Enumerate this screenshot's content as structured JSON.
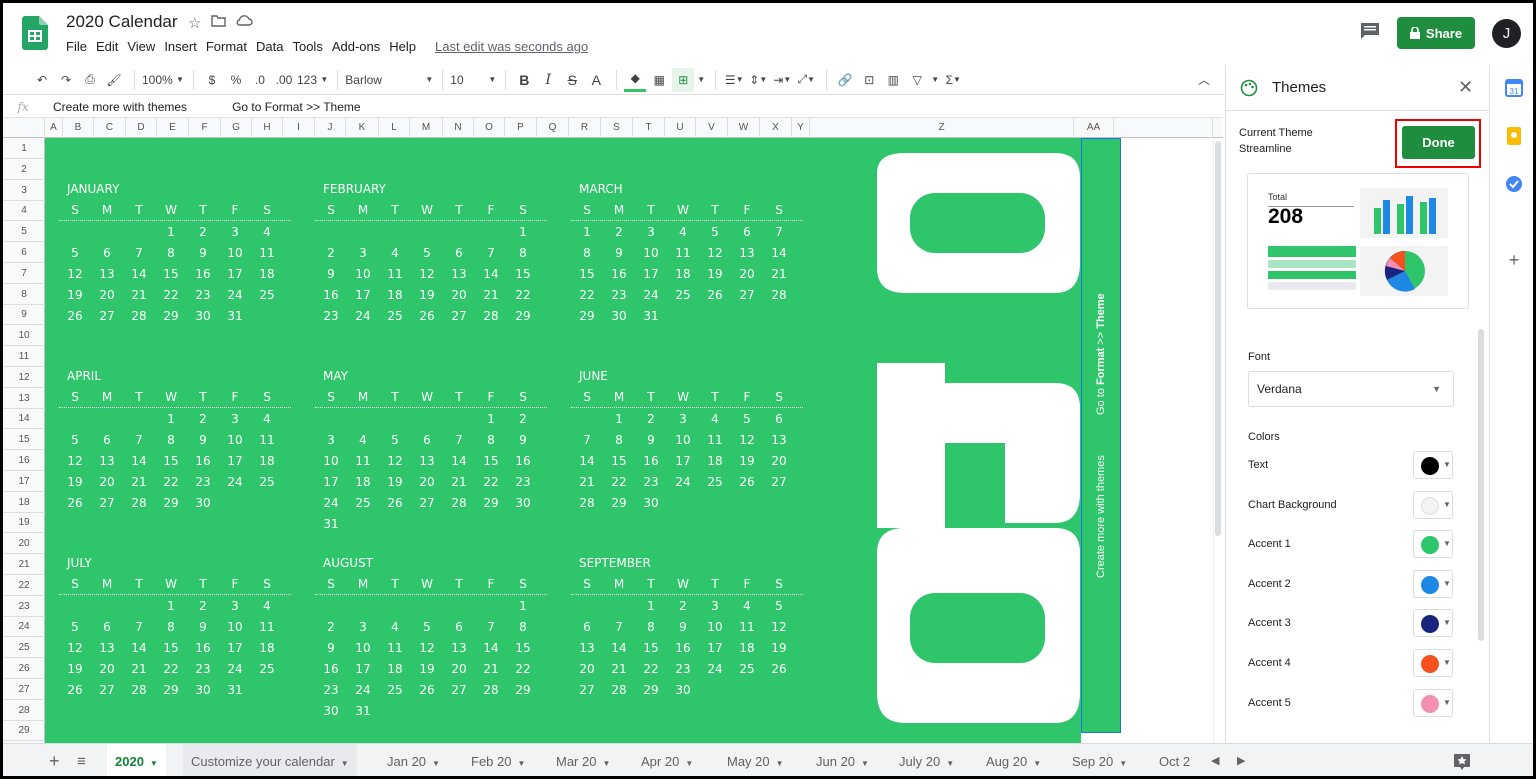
{
  "header": {
    "title": "2020 Calendar",
    "menu": [
      "File",
      "Edit",
      "View",
      "Insert",
      "Format",
      "Data",
      "Tools",
      "Add-ons",
      "Help"
    ],
    "last_edit": "Last edit was seconds ago",
    "share_label": "Share",
    "avatar_letter": "J"
  },
  "toolbar": {
    "zoom": "100%",
    "currency": "$",
    "percent": "%",
    "dec_less": ".0",
    "dec_more": ".00",
    "format_more": "123",
    "font": "Barlow",
    "font_size": "10",
    "bold": "B",
    "italic": "I",
    "strike": "S",
    "text_color": "A",
    "sum": "Σ"
  },
  "formula": {
    "fx": "fx",
    "text1": "Create more with themes",
    "text2": "Go to  Format  >> Theme"
  },
  "columns": [
    "A",
    "B",
    "C",
    "D",
    "E",
    "F",
    "G",
    "H",
    "I",
    "J",
    "K",
    "L",
    "M",
    "N",
    "O",
    "P",
    "Q",
    "R",
    "S",
    "T",
    "U",
    "V",
    "W",
    "X",
    "Y",
    "Z",
    "AA"
  ],
  "rows": [
    "1",
    "2",
    "3",
    "4",
    "5",
    "6",
    "7",
    "8",
    "9",
    "10",
    "11",
    "12",
    "13",
    "14",
    "15",
    "16",
    "17",
    "18",
    "19",
    "20",
    "21",
    "22",
    "23",
    "24",
    "25",
    "26",
    "27",
    "28",
    "29"
  ],
  "calendar": {
    "dow": [
      "S",
      "M",
      "T",
      "W",
      "T",
      "F",
      "S"
    ],
    "year_digits": [
      "2",
      "0",
      "2",
      "0"
    ],
    "side_text_1": "Create more with themes",
    "side_text_2_a": "Go to ",
    "side_text_2_b": "Format",
    "side_text_2_c": " >> ",
    "side_text_2_d": "Theme",
    "months": [
      {
        "name": "JANUARY",
        "weeks": [
          [
            "",
            "",
            "",
            "1",
            "2",
            "3",
            "4"
          ],
          [
            "5",
            "6",
            "7",
            "8",
            "9",
            "10",
            "11"
          ],
          [
            "12",
            "13",
            "14",
            "15",
            "16",
            "17",
            "18"
          ],
          [
            "19",
            "20",
            "21",
            "22",
            "23",
            "24",
            "25"
          ],
          [
            "26",
            "27",
            "28",
            "29",
            "30",
            "31",
            ""
          ]
        ]
      },
      {
        "name": "FEBRUARY",
        "weeks": [
          [
            "",
            "",
            "",
            "",
            "",
            "",
            "1"
          ],
          [
            "2",
            "3",
            "4",
            "5",
            "6",
            "7",
            "8"
          ],
          [
            "9",
            "10",
            "11",
            "12",
            "13",
            "14",
            "15"
          ],
          [
            "16",
            "17",
            "18",
            "19",
            "20",
            "21",
            "22"
          ],
          [
            "23",
            "24",
            "25",
            "26",
            "27",
            "28",
            "29"
          ]
        ]
      },
      {
        "name": "MARCH",
        "weeks": [
          [
            "1",
            "2",
            "3",
            "4",
            "5",
            "6",
            "7"
          ],
          [
            "8",
            "9",
            "10",
            "11",
            "12",
            "13",
            "14"
          ],
          [
            "15",
            "16",
            "17",
            "18",
            "19",
            "20",
            "21"
          ],
          [
            "22",
            "23",
            "24",
            "25",
            "26",
            "27",
            "28"
          ],
          [
            "29",
            "30",
            "31",
            "",
            "",
            "",
            ""
          ]
        ]
      },
      {
        "name": "APRIL",
        "weeks": [
          [
            "",
            "",
            "",
            "1",
            "2",
            "3",
            "4"
          ],
          [
            "5",
            "6",
            "7",
            "8",
            "9",
            "10",
            "11"
          ],
          [
            "12",
            "13",
            "14",
            "15",
            "16",
            "17",
            "18"
          ],
          [
            "19",
            "20",
            "21",
            "22",
            "23",
            "24",
            "25"
          ],
          [
            "26",
            "27",
            "28",
            "29",
            "30",
            "",
            ""
          ]
        ]
      },
      {
        "name": "MAY",
        "weeks": [
          [
            "",
            "",
            "",
            "",
            "",
            "1",
            "2"
          ],
          [
            "3",
            "4",
            "5",
            "6",
            "7",
            "8",
            "9"
          ],
          [
            "10",
            "11",
            "12",
            "13",
            "14",
            "15",
            "16"
          ],
          [
            "17",
            "18",
            "19",
            "20",
            "21",
            "22",
            "23"
          ],
          [
            "24",
            "25",
            "26",
            "27",
            "28",
            "29",
            "30"
          ],
          [
            "31",
            "",
            "",
            "",
            "",
            "",
            ""
          ]
        ]
      },
      {
        "name": "JUNE",
        "weeks": [
          [
            "",
            "1",
            "2",
            "3",
            "4",
            "5",
            "6"
          ],
          [
            "7",
            "8",
            "9",
            "10",
            "11",
            "12",
            "13"
          ],
          [
            "14",
            "15",
            "16",
            "17",
            "18",
            "19",
            "20"
          ],
          [
            "21",
            "22",
            "23",
            "24",
            "25",
            "26",
            "27"
          ],
          [
            "28",
            "29",
            "30",
            "",
            "",
            "",
            ""
          ]
        ]
      },
      {
        "name": "JULY",
        "weeks": [
          [
            "",
            "",
            "",
            "1",
            "2",
            "3",
            "4"
          ],
          [
            "5",
            "6",
            "7",
            "8",
            "9",
            "10",
            "11"
          ],
          [
            "12",
            "13",
            "14",
            "15",
            "16",
            "17",
            "18"
          ],
          [
            "19",
            "20",
            "21",
            "22",
            "23",
            "24",
            "25"
          ],
          [
            "26",
            "27",
            "28",
            "29",
            "30",
            "31",
            ""
          ]
        ]
      },
      {
        "name": "AUGUST",
        "weeks": [
          [
            "",
            "",
            "",
            "",
            "",
            "",
            "1"
          ],
          [
            "2",
            "3",
            "4",
            "5",
            "6",
            "7",
            "8"
          ],
          [
            "9",
            "10",
            "11",
            "12",
            "13",
            "14",
            "15"
          ],
          [
            "16",
            "17",
            "18",
            "19",
            "20",
            "21",
            "22"
          ],
          [
            "23",
            "24",
            "25",
            "26",
            "27",
            "28",
            "29"
          ],
          [
            "30",
            "31",
            "",
            "",
            "",
            "",
            ""
          ]
        ]
      },
      {
        "name": "SEPTEMBER",
        "weeks": [
          [
            "",
            "",
            "1",
            "2",
            "3",
            "4",
            "5"
          ],
          [
            "6",
            "7",
            "8",
            "9",
            "10",
            "11",
            "12"
          ],
          [
            "13",
            "14",
            "15",
            "16",
            "17",
            "18",
            "19"
          ],
          [
            "20",
            "21",
            "22",
            "23",
            "24",
            "25",
            "26"
          ],
          [
            "27",
            "28",
            "29",
            "30",
            "",
            "",
            ""
          ]
        ]
      }
    ]
  },
  "themes_panel": {
    "title": "Themes",
    "current_theme_label": "Current Theme",
    "current_theme_name": "Streamline",
    "done_label": "Done",
    "preview_total_label": "Total",
    "preview_total_value": "208",
    "font_label": "Font",
    "font_value": "Verdana",
    "colors_label": "Colors",
    "colors": [
      {
        "label": "Text",
        "color": "#000000"
      },
      {
        "label": "Chart Background",
        "color": "#f3f3f3"
      },
      {
        "label": "Accent 1",
        "color": "#2ec56b"
      },
      {
        "label": "Accent 2",
        "color": "#1e88e5"
      },
      {
        "label": "Accent 3",
        "color": "#1a237e"
      },
      {
        "label": "Accent 4",
        "color": "#f4511e"
      },
      {
        "label": "Accent 5",
        "color": "#f48fb1"
      }
    ]
  },
  "tabs": [
    {
      "label": "2020",
      "active": true
    },
    {
      "label": "Customize your calendar"
    },
    {
      "label": "Jan 20"
    },
    {
      "label": "Feb 20"
    },
    {
      "label": "Mar 20"
    },
    {
      "label": "Apr 20"
    },
    {
      "label": "May 20"
    },
    {
      "label": "Jun 20"
    },
    {
      "label": "July 20"
    },
    {
      "label": "Aug 20"
    },
    {
      "label": "Sep 20"
    },
    {
      "label": "Oct 2"
    }
  ],
  "colors": {
    "brand_green": "#2ec56b",
    "share_green": "#1e8e3e",
    "highlight_red": "#e00000"
  }
}
